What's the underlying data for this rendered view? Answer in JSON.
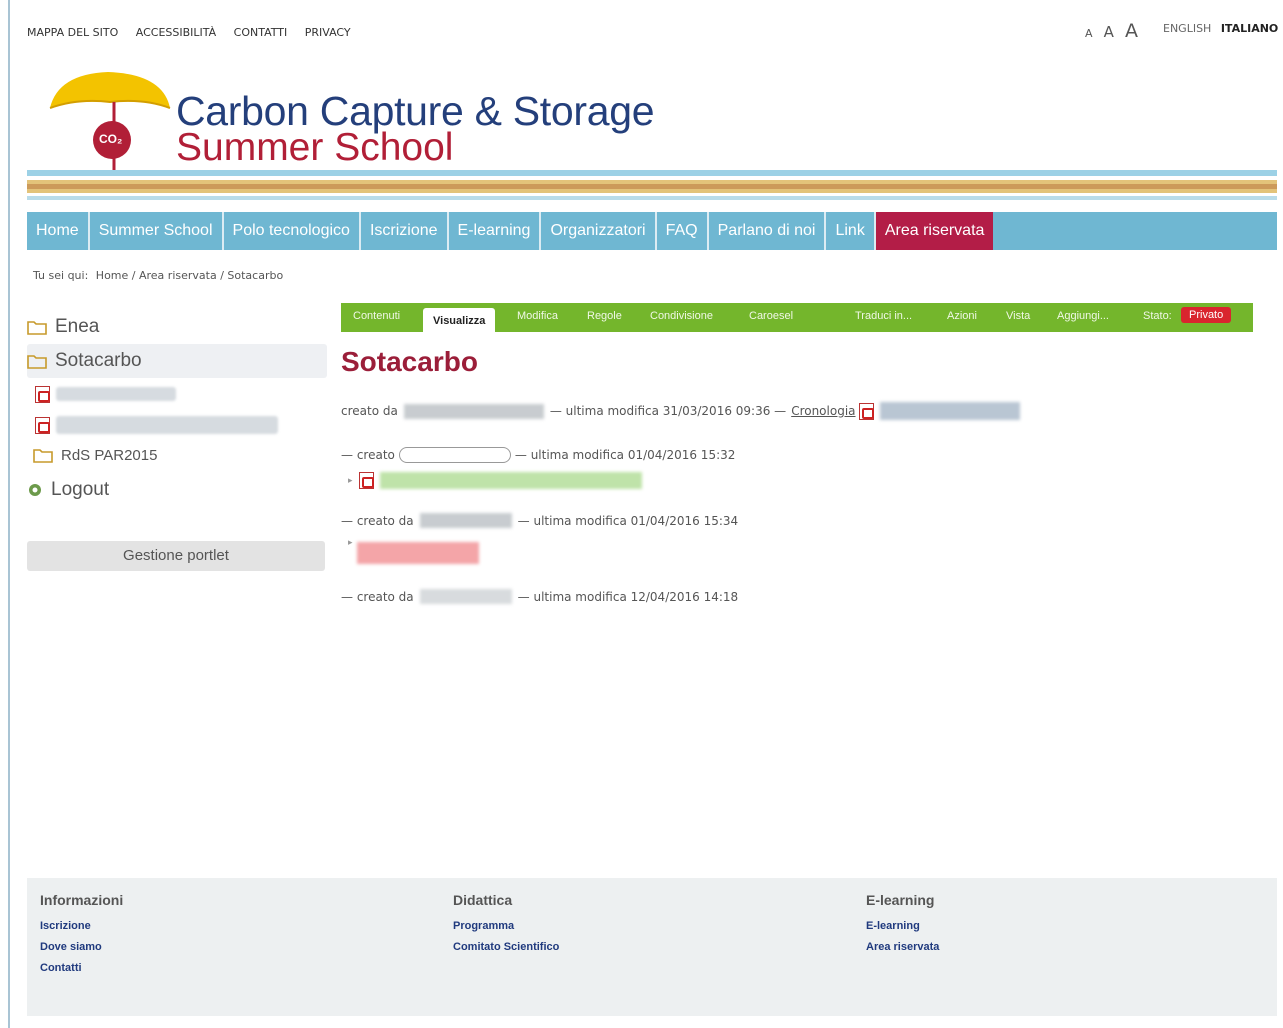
{
  "top_links": [
    "MAPPA DEL SITO",
    "ACCESSIBILITÀ",
    "CONTATTI",
    "PRIVACY"
  ],
  "font_sizes": [
    "A",
    "A",
    "A"
  ],
  "languages": {
    "english": "ENGLISH",
    "italiano": "ITALIANO"
  },
  "logo": {
    "co2": "CO₂",
    "title_line1": "Carbon Capture & Storage",
    "title_line2": "Summer School"
  },
  "main_nav": [
    "Home",
    "Summer School",
    "Polo tecnologico",
    "Iscrizione",
    "E-learning",
    "Organizzatori",
    "FAQ",
    "Parlano di noi",
    "Link",
    "Area riservata"
  ],
  "breadcrumb": {
    "prefix": "Tu sei qui:",
    "items": [
      "Home",
      "Area riservata",
      "Sotacarbo"
    ],
    "sep": " / "
  },
  "portlet": {
    "items": [
      {
        "label": "Enea",
        "icon": "folder-icon"
      },
      {
        "label": "Sotacarbo",
        "icon": "folder-icon"
      },
      {
        "label": "",
        "icon": "pdf-icon"
      },
      {
        "label": "",
        "icon": "pdf-icon"
      },
      {
        "label": "RdS PAR2015",
        "icon": "folder-icon"
      },
      {
        "label": "Logout",
        "icon": "logout-icon"
      }
    ],
    "manage_button": "Gestione portlet"
  },
  "edit_bar": {
    "tabs": [
      "Contenuti",
      "Visualizza",
      "Modifica",
      "Regole",
      "Condivisione",
      "Caroesel"
    ],
    "menus": [
      "Traduci in...",
      "Azioni",
      "Vista",
      "Aggiungi...",
      "Stato:"
    ],
    "state": "Privato"
  },
  "page_title": "Sotacarbo",
  "entries": [
    {
      "created": "creato da",
      "modified": "— ultima modifica 31/03/2016 09:36 —",
      "history": "Cronologia"
    },
    {
      "created": "— creato",
      "modified": "— ultima modifica 01/04/2016 15:32"
    },
    {
      "created": "— creato da",
      "modified": "— ultima modifica 01/04/2016 15:34"
    },
    {
      "created": "— creato da",
      "modified": "— ultima modifica 12/04/2016 14:18"
    }
  ],
  "footer": [
    {
      "heading": "Informazioni",
      "links": [
        "Iscrizione",
        "Dove siamo",
        "Contatti"
      ]
    },
    {
      "heading": "Didattica",
      "links": [
        "Programma",
        "Comitato Scientifico"
      ]
    },
    {
      "heading": "E-learning",
      "links": [
        "E-learning",
        "Area riservata"
      ]
    }
  ],
  "colors": {
    "nav": "#6fb7d2",
    "nav_active": "#b31d47",
    "title_blue": "#243f7b",
    "title_red": "#b11f37",
    "editbar": "#74b62c"
  }
}
